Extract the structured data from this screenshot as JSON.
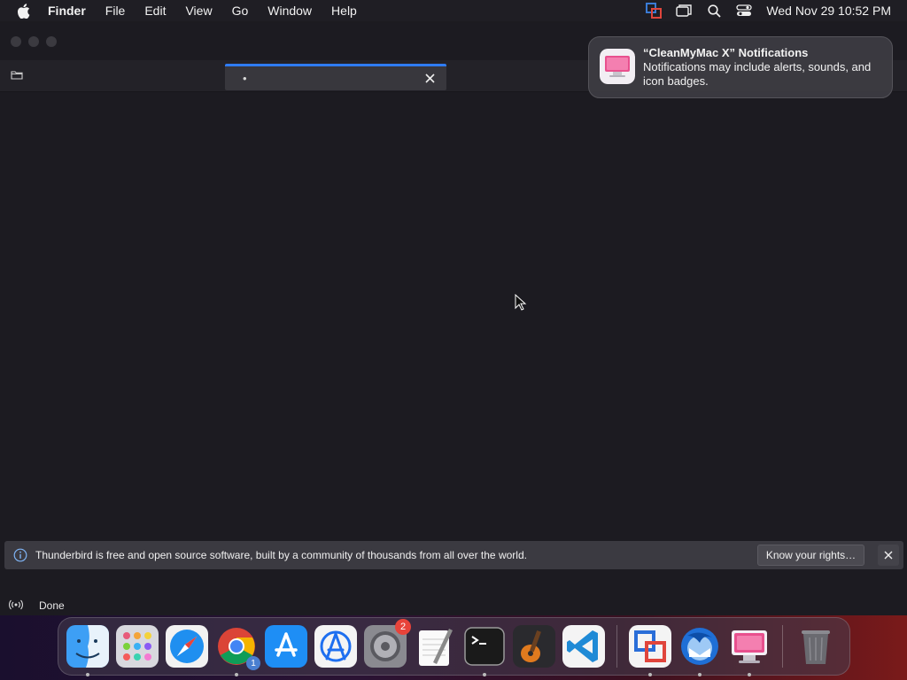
{
  "menubar": {
    "app_name": "Finder",
    "items": [
      "File",
      "Edit",
      "View",
      "Go",
      "Window",
      "Help"
    ],
    "clock": "Wed Nov 29  10:52 PM"
  },
  "search": {
    "value": "•"
  },
  "notification": {
    "app_title": "“CleanMyMac X” Notifications",
    "body": "Notifications may include alerts, sounds, and icon badges."
  },
  "infobar": {
    "message": "Thunderbird is free and open source software, built by a community of thousands from all over the world.",
    "button_label": "Know your rights…"
  },
  "statusbar": {
    "text": "Done"
  },
  "dock": {
    "system_preferences_badge": "2",
    "chrome_badge": "1"
  },
  "colors": {
    "accent": "#2f7cf6",
    "badge": "#e8433a"
  }
}
